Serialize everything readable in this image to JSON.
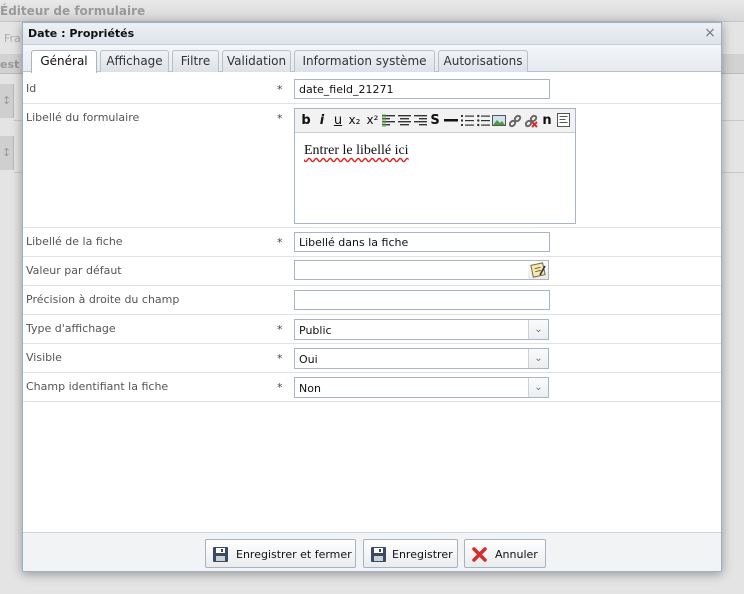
{
  "background": {
    "title": "Éditeur de formulaire",
    "toolbar_text": "Fra",
    "row_text": "est"
  },
  "dialog": {
    "title": "Date : Propriétés",
    "close_glyph": "×",
    "tabs": [
      {
        "label": "Général",
        "active": true
      },
      {
        "label": "Affichage"
      },
      {
        "label": "Filtre"
      },
      {
        "label": "Validation"
      },
      {
        "label": "Information système"
      },
      {
        "label": "Autorisations"
      }
    ]
  },
  "form": {
    "required_mark": "*",
    "id": {
      "label": "Id",
      "value": "date_field_21271"
    },
    "libelle_formulaire": {
      "label": "Libellé du formulaire",
      "content": "Entrer le libellé ici"
    },
    "libelle_fiche": {
      "label": "Libellé de la fiche",
      "value": "Libellé dans la fiche"
    },
    "valeur_defaut": {
      "label": "Valeur par défaut",
      "value": ""
    },
    "precision": {
      "label": "Précision à droite du champ",
      "value": ""
    },
    "type_affichage": {
      "label": "Type d'affichage",
      "value": "Public"
    },
    "visible": {
      "label": "Visible",
      "value": "Oui"
    },
    "champ_identifiant": {
      "label": "Champ identifiant la fiche",
      "value": "Non"
    }
  },
  "rte_toolbar": {
    "bold": "b",
    "italic": "i",
    "underline": "u",
    "subscript": "x₂",
    "superscript": "x²",
    "strikethrough": "S",
    "special_char": "n"
  },
  "footer": {
    "save_close": "Enregistrer et fermer",
    "save": "Enregistrer",
    "cancel": "Annuler"
  },
  "colors": {
    "cancel_icon": "#d32f2f",
    "accent": "#5a7592"
  }
}
